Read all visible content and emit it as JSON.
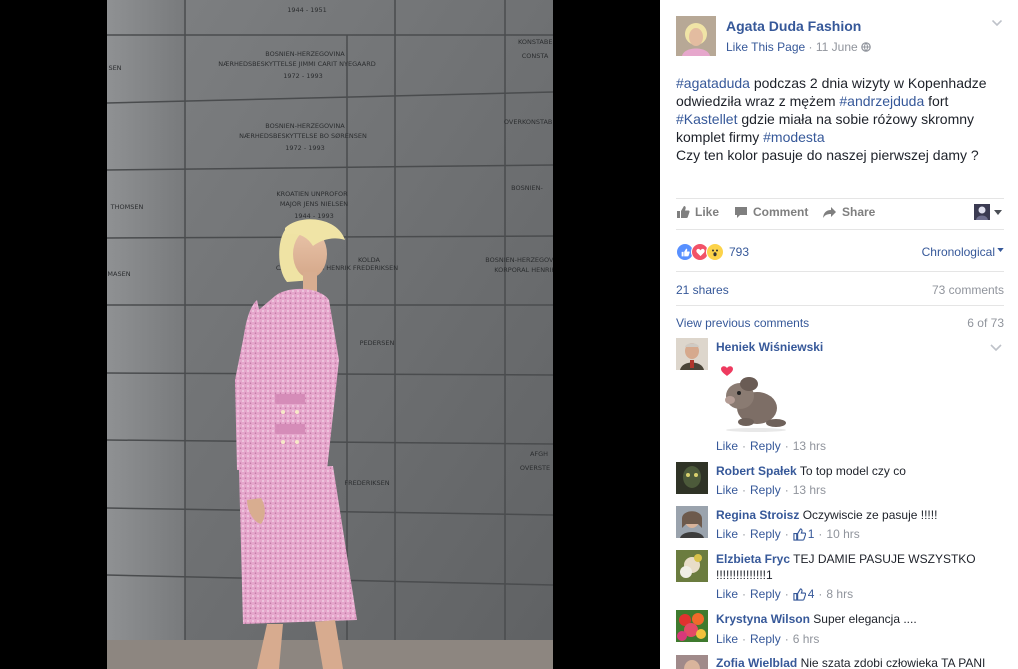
{
  "page": {
    "name": "Agata Duda Fashion",
    "like_link": "Like This Page",
    "date": "11 June"
  },
  "post": {
    "parts": [
      {
        "text": "#agataduda",
        "tag": true
      },
      {
        "text": " podczas 2 dnia wizyty w Kopenhadze odwiedziła wraz z mężem ",
        "tag": false
      },
      {
        "text": "#andrzejduda",
        "tag": true
      },
      {
        "text": " fort ",
        "tag": false
      },
      {
        "text": "#Kastellet",
        "tag": true
      },
      {
        "text": " gdzie miała na sobie różowy skromny komplet firmy ",
        "tag": false
      },
      {
        "text": "#modesta",
        "tag": true
      }
    ],
    "question": "Czy ten kolor pasuje do naszej pierwszej damy ?"
  },
  "actions": {
    "like": "Like",
    "comment": "Comment",
    "share": "Share"
  },
  "stats": {
    "reactions": "793",
    "order": "Chronological",
    "shares": "21 shares",
    "comments": "73 comments",
    "view_previous": "View previous comments",
    "pagination": "6 of 73"
  },
  "comments": [
    {
      "name": "Heniek Wiśniewski",
      "text": "",
      "like_label": "Like",
      "reply_label": "Reply",
      "likes": "",
      "time": "13 hrs",
      "sticker": "dog-heart-sticker"
    },
    {
      "name": "Robert Spałek",
      "text": "To top model czy co",
      "like_label": "Like",
      "reply_label": "Reply",
      "likes": "",
      "time": "13 hrs"
    },
    {
      "name": "Regina Stroisz",
      "text": "Oczywiscie ze pasuje !!!!!",
      "like_label": "Like",
      "reply_label": "Reply",
      "likes": "1",
      "time": "10 hrs"
    },
    {
      "name": "Elzbieta Fryc",
      "text": "TEJ DAMIE PASUJE WSZYSTKO !!!!!!!!!!!!!!!1",
      "like_label": "Like",
      "reply_label": "Reply",
      "likes": "4",
      "time": "8 hrs"
    },
    {
      "name": "Krystyna Wilson",
      "text": "Super elegancja ....",
      "like_label": "Like",
      "reply_label": "Reply",
      "likes": "",
      "time": "6 hrs"
    },
    {
      "name": "Zofia Wielblad",
      "text": "Nie szata zdobi człowieka TA PANI",
      "like_label": "",
      "reply_label": "",
      "likes": "",
      "time": ""
    }
  ],
  "photo": {
    "wall_text": [
      "1944 - 1951",
      "BOSNIEN-HERZEGOVINA",
      "NÆRHEDSBESKYTTELSE JIMMI CARIT NYEGAARD",
      "1972 - 1993",
      "BOSNIEN-HERZEGOVINA",
      "NÆRHEDSBESKYTTELSE BO SØRENSEN",
      "1972 - 1993",
      "KROATIEN UNPROFOR",
      "MAJOR JENS NIELSEN",
      "1944 - 1993",
      "CAPTAIN NIELS HENRIK FREDERIKSEN",
      "BOSNIEN-HERZEGOVINA",
      "KORPORAL HENRIK",
      "OVERKONSTABEL",
      "KONSTABEL",
      "THOMSEN",
      "MASEN",
      "SEN",
      "BOSNIEN-",
      "CONSTA",
      "OVERSTE",
      "PEDERSEN",
      "FREDERIKSEN",
      "KOLDA",
      "AFGH"
    ]
  },
  "colors": {
    "link": "#365899",
    "grey_text": "#90949c",
    "suit_pink": "#e8a6cc"
  }
}
